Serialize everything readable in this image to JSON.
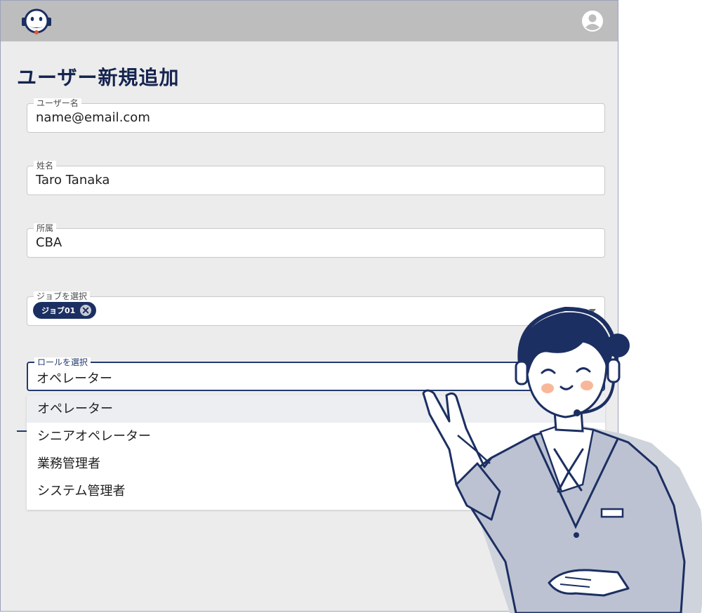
{
  "header": {
    "logo_icon": "robot-face-icon",
    "account_icon": "account-circle-icon"
  },
  "page": {
    "title": "ユーザー新規追加"
  },
  "form": {
    "username": {
      "label": "ユーザー名",
      "value": "name@email.com"
    },
    "fullname": {
      "label": "姓名",
      "value": "Taro Tanaka"
    },
    "organization": {
      "label": "所属",
      "value": "CBA"
    },
    "job": {
      "label": "ジョブを選択",
      "chips": [
        "ジョブ01"
      ],
      "chip_remove_icon": "close-circle-icon"
    },
    "role": {
      "label": "ロールを選択",
      "value": "オペレーター"
    }
  },
  "role_options": [
    "オペレーター",
    "シニアオペレーター",
    "業務管理者",
    "システム管理者"
  ],
  "colors": {
    "navy": "#15244f",
    "top_bar": "#bdbdbd",
    "background": "#ececec",
    "chip": "#1c2f62",
    "blush": "#f7b89a"
  }
}
